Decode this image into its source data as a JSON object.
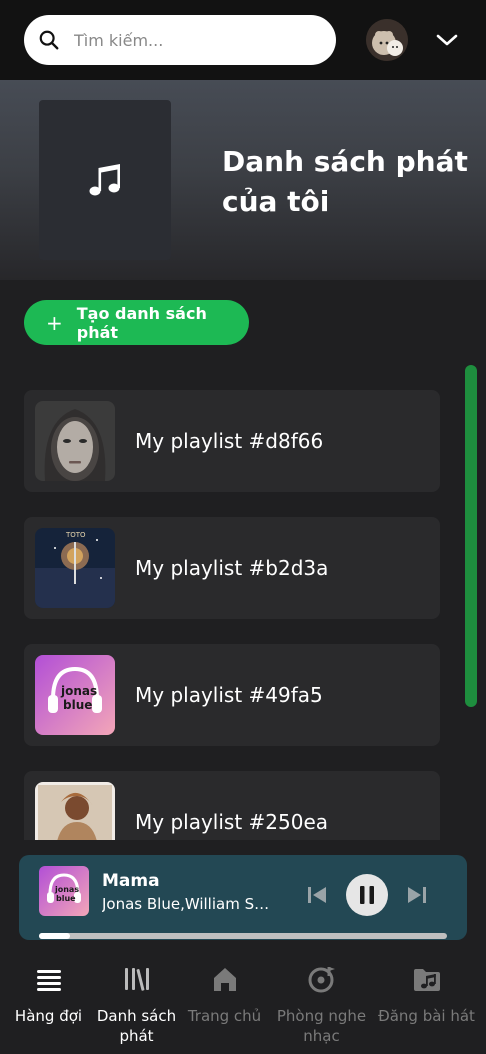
{
  "search": {
    "placeholder": "Tìm kiếm..."
  },
  "banner": {
    "title": "Danh sách phát của tôi"
  },
  "create_button": {
    "label": "Tạo danh sách phát"
  },
  "playlists": [
    {
      "label": "My playlist #d8f66",
      "cover": "adele-portrait"
    },
    {
      "label": "My playlist #b2d3a",
      "cover": "toto-album"
    },
    {
      "label": "My playlist #49fa5",
      "cover": "jonas-blue-album"
    },
    {
      "label": "My playlist #250ea",
      "cover": "beyonce-album"
    }
  ],
  "now_playing": {
    "title": "Mama",
    "artist": "Jonas Blue,William Sin...",
    "progress": 0.075
  },
  "nav": [
    {
      "label": "Hàng đợi",
      "icon": "queue-icon",
      "active": true
    },
    {
      "label": "Danh sách phát",
      "icon": "library-icon",
      "active": true
    },
    {
      "label": "Trang chủ",
      "icon": "home-icon",
      "active": false
    },
    {
      "label": "Phòng nghe nhạc",
      "icon": "music-room-icon",
      "active": false
    },
    {
      "label": "Đăng bài hát",
      "icon": "upload-song-icon",
      "active": false
    }
  ],
  "colors": {
    "accent": "#1db954",
    "player_bg": "#234854",
    "background": "#1f1f21"
  }
}
